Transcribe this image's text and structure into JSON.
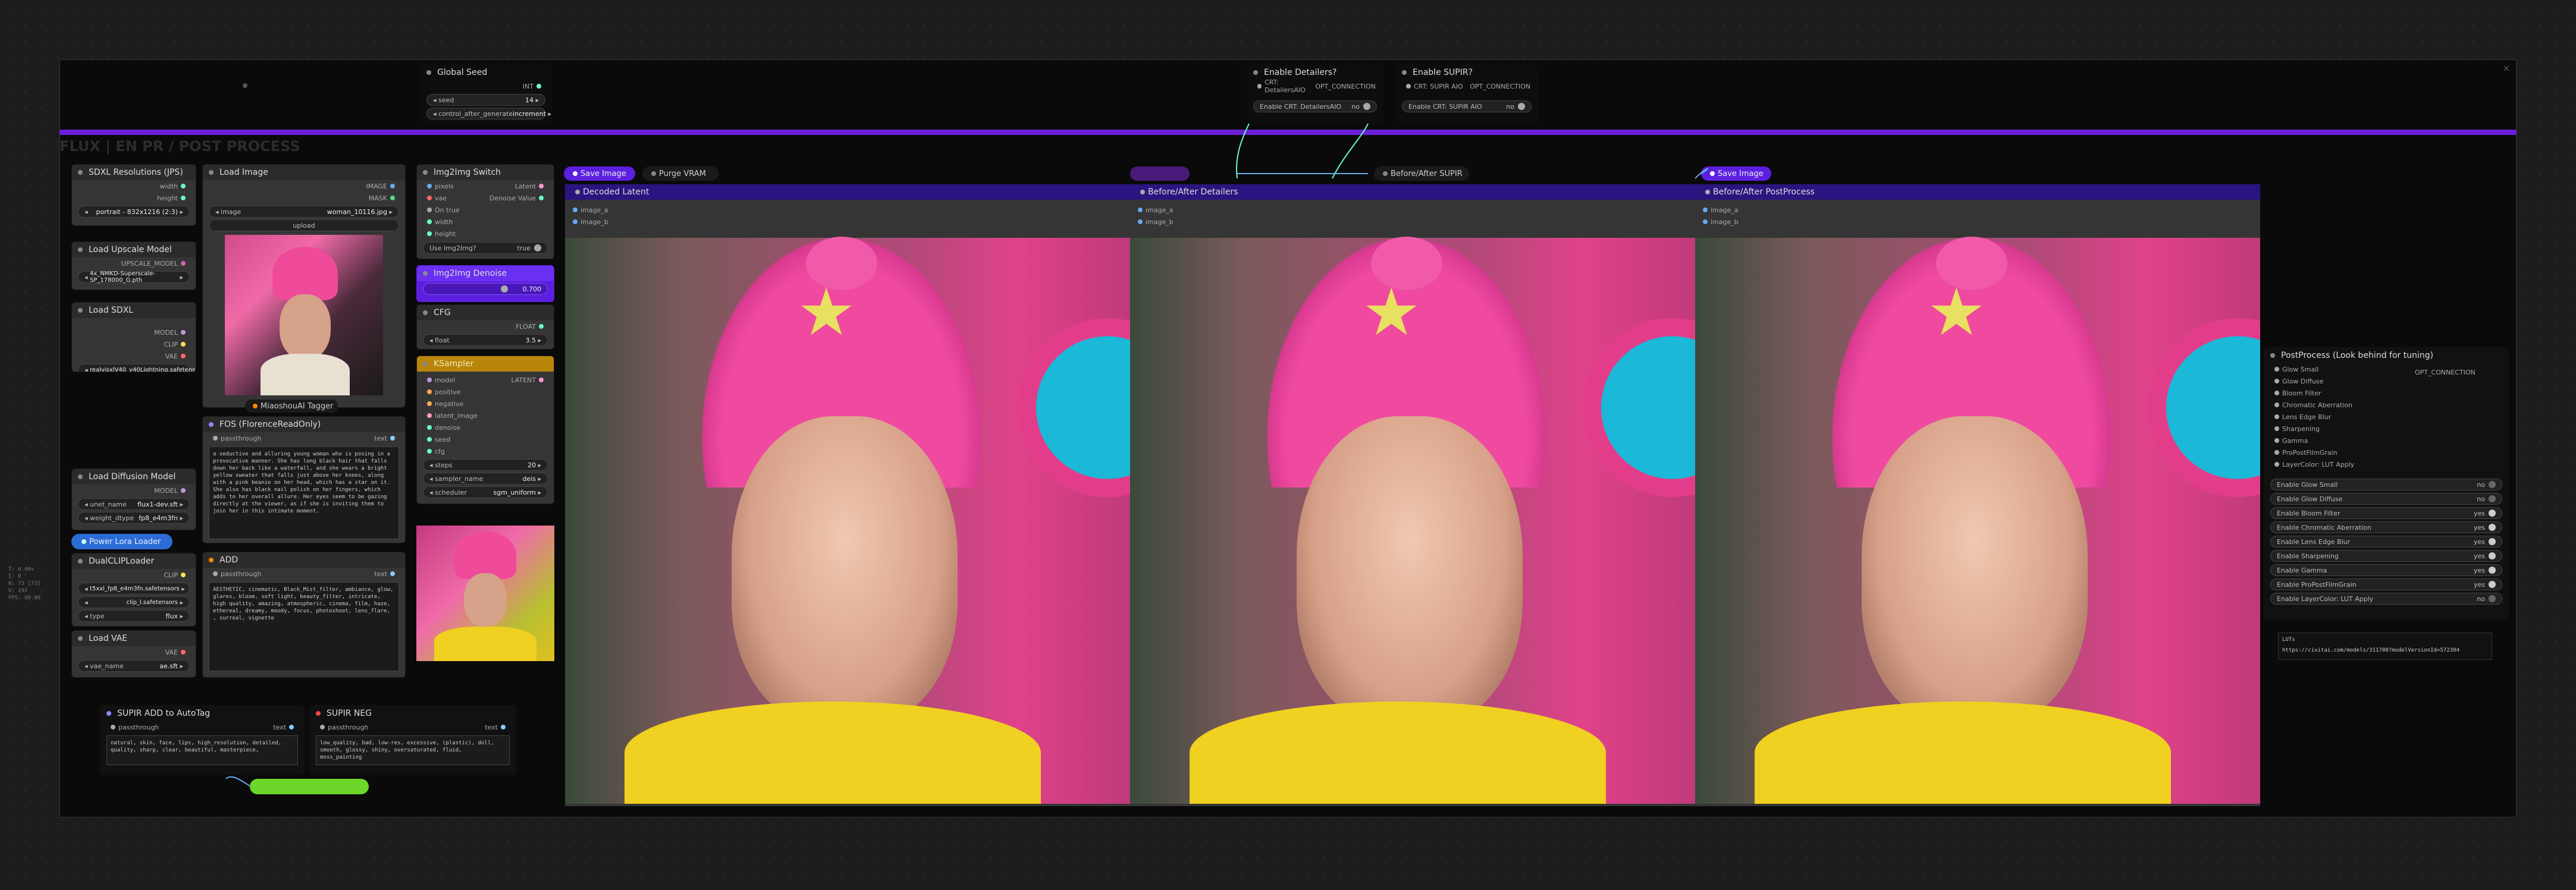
{
  "group_title": "FLUX | EN PR / POST PROCESS",
  "global_seed": {
    "title": "Global Seed",
    "out": "INT",
    "seed_label": "seed",
    "seed_value": "14",
    "cag_label": "control_after_generate",
    "cag_value": "increment"
  },
  "enable_detailers": {
    "title": "Enable Detailers?",
    "socket": "CRT: DetailersAIO",
    "out": "OPT_CONNECTION",
    "toggle_label": "Enable CRT: DetailersAIO",
    "toggle_value": "no"
  },
  "enable_supir": {
    "title": "Enable SUPIR?",
    "socket": "CRT: SUPIR AIO",
    "out": "OPT_CONNECTION",
    "toggle_label": "Enable CRT: SUPIR AIO",
    "toggle_value": "no"
  },
  "sdxl_res": {
    "title": "SDXL Resolutions (JPS)",
    "out_width": "width",
    "out_height": "height",
    "value": "portrait - 832x1216 (2:3)"
  },
  "upscale_model": {
    "title": "Load Upscale Model",
    "out": "UPSCALE_MODEL",
    "value": "4x_NMKD-Superscale-SP_178000_G.pth"
  },
  "load_sdxl": {
    "title": "Load SDXL",
    "o1": "MODEL",
    "o2": "CLIP",
    "o3": "VAE",
    "value": "realvisxlV40_v40Lightning.safetensors"
  },
  "diffusion_model": {
    "title": "Load Diffusion Model",
    "out": "MODEL",
    "unet_label": "unet_name",
    "unet_value": "flux1-dev.sft",
    "wdt_label": "weight_dtype",
    "wdt_value": "fp8_e4m3fn"
  },
  "power_lora": {
    "title": "Power Lora Loader"
  },
  "dual_clip": {
    "title": "DualCLIPLoader",
    "out": "CLIP",
    "c1": "clip_l.safetensors",
    "c2": "t5xxl_fp8_e4m3fn.safetensors",
    "type_label": "type",
    "type_value": "flux"
  },
  "load_vae": {
    "title": "Load VAE",
    "out": "VAE",
    "label": "vae_name",
    "value": "ae.sft"
  },
  "load_image": {
    "title": "Load Image",
    "o1": "IMAGE",
    "o2": "MASK",
    "image_label": "image",
    "image_value": "woman_10116.jpg",
    "upload": "upload"
  },
  "tagger": {
    "title": "MiaoshouAI Tagger"
  },
  "florence": {
    "title": "FOS (FlorenceReadOnly)",
    "in": "passthrough",
    "out": "text",
    "text": "a seductive and alluring young woman who is posing in a provocative manner. She has long black hair that falls down her back like a waterfall, and she wears a bright yellow sweater that falls just above her knees, along with a pink beanie on her head, which has a star on it. She also has black nail polish on her fingers, which adds to her overall allure. Her eyes seem to be gazing directly at the viewer, as if she is inviting them to join her in this intimate moment."
  },
  "add_node": {
    "title": "ADD",
    "in": "passthrough",
    "out": "text",
    "text": "AESTHETIC, cinematic, Black_Mist_filter, ambiance, glow, glares, bloom, soft light, beauty_filter, intricate, high quality, amazing, atmospheric, cinema, film, haze, ethereal, dreamy, moody, focus, photoshoot, lens_flare, , surreal, vignette"
  },
  "img2img_switch": {
    "title": "Img2Img Switch",
    "i1": "pixels",
    "i2": "vae",
    "i3": "On true",
    "i4": "width",
    "i5": "height",
    "o1": "Latent",
    "o2": "Denoise Value",
    "toggle_label": "Use Img2Img?",
    "toggle_value": "true"
  },
  "img2img_denoise": {
    "title": "Img2Img Denoise",
    "value": "0.700"
  },
  "cfg": {
    "title": "CFG",
    "out": "FLOAT",
    "label": "float",
    "value": "3.5"
  },
  "sampler": {
    "title": "KSampler",
    "i1": "model",
    "i2": "positive",
    "i3": "negative",
    "i4": "latent_image",
    "i5": "denoise",
    "i6": "seed",
    "i7": "cfg",
    "o1": "LATENT",
    "steps_label": "steps",
    "steps_value": "20",
    "sn_label": "sampler_name",
    "sn_value": "deis",
    "sch_label": "scheduler",
    "sch_value": "sgm_uniform"
  },
  "save_image_1": {
    "title": "Save Image"
  },
  "purge_vram": {
    "title": "Purge VRAM"
  },
  "decoded_latent": {
    "title": "Decoded Latent",
    "a": "image_a",
    "b": "image_b"
  },
  "ba_detailers": {
    "title": "Before/After Detailers",
    "a": "image_a",
    "b": "image_b"
  },
  "ba_supir": {
    "title": "Before/After SUPIR"
  },
  "save_image_2": {
    "title": "Save Image"
  },
  "ba_post": {
    "title": "Before/After PostProcess",
    "a": "image_a",
    "b": "image_b"
  },
  "postprocess": {
    "title": "PostProcess (Look behind for tuning)",
    "out": "OPT_CONNECTION",
    "inputs": [
      "Glow Small",
      "Glow Diffuse",
      "Bloom Filter",
      "Chromatic Aberration",
      "Lens Edge Blur",
      "Sharpening",
      "Gamma",
      "ProPostFilmGrain",
      "LayerColor: LUT Apply"
    ],
    "toggles": [
      {
        "label": "Enable Glow Small",
        "value": "no"
      },
      {
        "label": "Enable Glow Diffuse",
        "value": "no"
      },
      {
        "label": "Enable Bloom Filter",
        "value": "yes"
      },
      {
        "label": "Enable Chromatic Aberration",
        "value": "yes"
      },
      {
        "label": "Enable Lens Edge Blur",
        "value": "yes"
      },
      {
        "label": "Enable Sharpening",
        "value": "yes"
      },
      {
        "label": "Enable Gamma",
        "value": "yes"
      },
      {
        "label": "Enable ProPostFilmGrain",
        "value": "yes"
      },
      {
        "label": "Enable LayerColor: LUT Apply",
        "value": "no"
      }
    ]
  },
  "lut_note": {
    "label": "LUTs",
    "url": "https://civitai.com/models/311700?modelVersionId=572304"
  },
  "supir_add": {
    "title": "SUPIR ADD to AutoTag",
    "in": "passthrough",
    "out": "text",
    "text": "natural, skin, face, lips, high_resolution, detailed, quality, sharp, clear, beautiful, masterpiece,"
  },
  "supir_neg": {
    "title": "SUPIR NEG",
    "in": "passthrough",
    "out": "text",
    "text": "low_quality, bad, low-res, excessive, (plastic), doll, smooth, glossy, shiny, oversaturated, fluid, moss_painting"
  },
  "stats": {
    "l1": "T: 0.00s",
    "l2": "I: 0",
    "l3": "N: 73 [73]",
    "l4": "V: 297",
    "l5": "FPS: 60.00"
  },
  "colors": {
    "purple": "#6a1fd6",
    "violet": "#5c1fe0",
    "green": "#6cd62a",
    "gold": "#b8860b"
  }
}
